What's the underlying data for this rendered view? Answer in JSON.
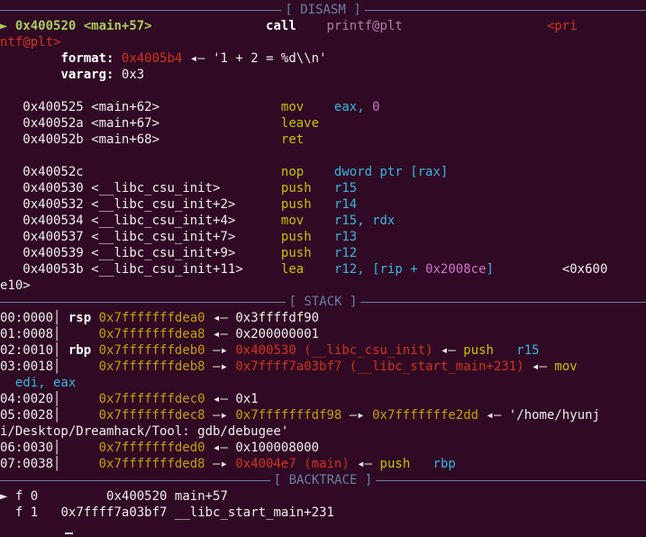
{
  "disasm": {
    "title": "[ DISASM ]",
    "current": {
      "marker": "►",
      "addr": "0x400520",
      "sym": "<main+57>",
      "mnemonic": "call",
      "operand": "printf@plt",
      "target_a": "<pri",
      "target_b": "ntf@plt>"
    },
    "format": {
      "label": "format:",
      "addr": "0x4005b4",
      "arrow": "◂—",
      "str": "'1 + 2 = %d\\\\n'"
    },
    "vararg": {
      "label": "vararg:",
      "value": "0x3"
    },
    "rows": [
      {
        "addr": "0x400525",
        "sym": "<main+62>",
        "mnemonic": "mov",
        "ops": [
          [
            "eax, ",
            "c"
          ],
          [
            "0",
            "m"
          ]
        ]
      },
      {
        "addr": "0x40052a",
        "sym": "<main+67>",
        "mnemonic": "leave",
        "ops": []
      },
      {
        "addr": "0x40052b",
        "sym": "<main+68>",
        "mnemonic": "ret",
        "ops": []
      },
      {
        "addr": "0x40052c",
        "sym": "",
        "mnemonic": "nop",
        "ops": [
          [
            "dword ptr [",
            "c"
          ],
          [
            "rax",
            "c"
          ],
          [
            "]",
            "c"
          ]
        ]
      },
      {
        "addr": "0x400530",
        "sym": "<__libc_csu_init>",
        "mnemonic": "push",
        "ops": [
          [
            "r15",
            "c"
          ]
        ]
      },
      {
        "addr": "0x400532",
        "sym": "<__libc_csu_init+2>",
        "mnemonic": "push",
        "ops": [
          [
            "r14",
            "c"
          ]
        ]
      },
      {
        "addr": "0x400534",
        "sym": "<__libc_csu_init+4>",
        "mnemonic": "mov",
        "ops": [
          [
            "r15, rdx",
            "c"
          ]
        ]
      },
      {
        "addr": "0x400537",
        "sym": "<__libc_csu_init+7>",
        "mnemonic": "push",
        "ops": [
          [
            "r13",
            "c"
          ]
        ]
      },
      {
        "addr": "0x400539",
        "sym": "<__libc_csu_init+9>",
        "mnemonic": "push",
        "ops": [
          [
            "r12",
            "c"
          ]
        ]
      },
      {
        "addr": "0x40053b",
        "sym": "<__libc_csu_init+11>",
        "mnemonic": "lea",
        "ops": [
          [
            "r12, [rip + ",
            "c"
          ],
          [
            "0x2008ce",
            "m"
          ],
          [
            "]",
            "c"
          ]
        ]
      }
    ],
    "lea_target_a": "<0x600",
    "lea_target_b": "e10>"
  },
  "stack": {
    "title": "[ STACK ]",
    "rows": [
      "00:0000",
      "01:0008",
      "02:0010",
      "03:0018",
      "04:0020",
      "05:0028",
      "06:0030",
      "07:0038"
    ],
    "rsp": "rsp",
    "rbp": "rbp",
    "addrs": [
      "0x7fffffffdea0",
      "0x7fffffffdea8",
      "0x7fffffffdeb0",
      "0x7fffffffdeb8",
      "0x7fffffffdec0",
      "0x7fffffffdec8",
      "0x7fffffffded0",
      "0x7fffffffded8"
    ],
    "vals": {
      "r0": "0x3ffffdf90",
      "r1": "0x200000001",
      "r2_addr": "0x400530",
      "r2_sym": "(__libc_csu_init)",
      "r2_ins": "push",
      "r2_op": "r15",
      "r3_addr": "0x7ffff7a03bf7",
      "r3_sym": "(__libc_start_main+231)",
      "r3_ins": "mov",
      "r3_cont": "edi, eax",
      "r4": "0x1",
      "r5_a": "0x7fffffffdf98",
      "r5_b": "0x7fffffffe2dd",
      "r5_str_a": "'/home/hyunj",
      "r5_str_b": "i/Desktop/Dreamhack/Tool: gdb/debugee'",
      "r6": "0x100008000",
      "r7_addr": "0x4004e7",
      "r7_sym": "(main)",
      "r7_ins": "push",
      "r7_op": "rbp"
    },
    "arrow_left": "◂—",
    "arrow_right": "—▸"
  },
  "backtrace": {
    "title": "[ BACKTRACE ]",
    "frames": [
      {
        "marker": "►",
        "f": "f 0",
        "addr": "0x400520",
        "sym": "main+57"
      },
      {
        "marker": " ",
        "f": "f 1",
        "addr": "0x7ffff7a03bf7",
        "sym": "__libc_start_main+231"
      }
    ]
  }
}
